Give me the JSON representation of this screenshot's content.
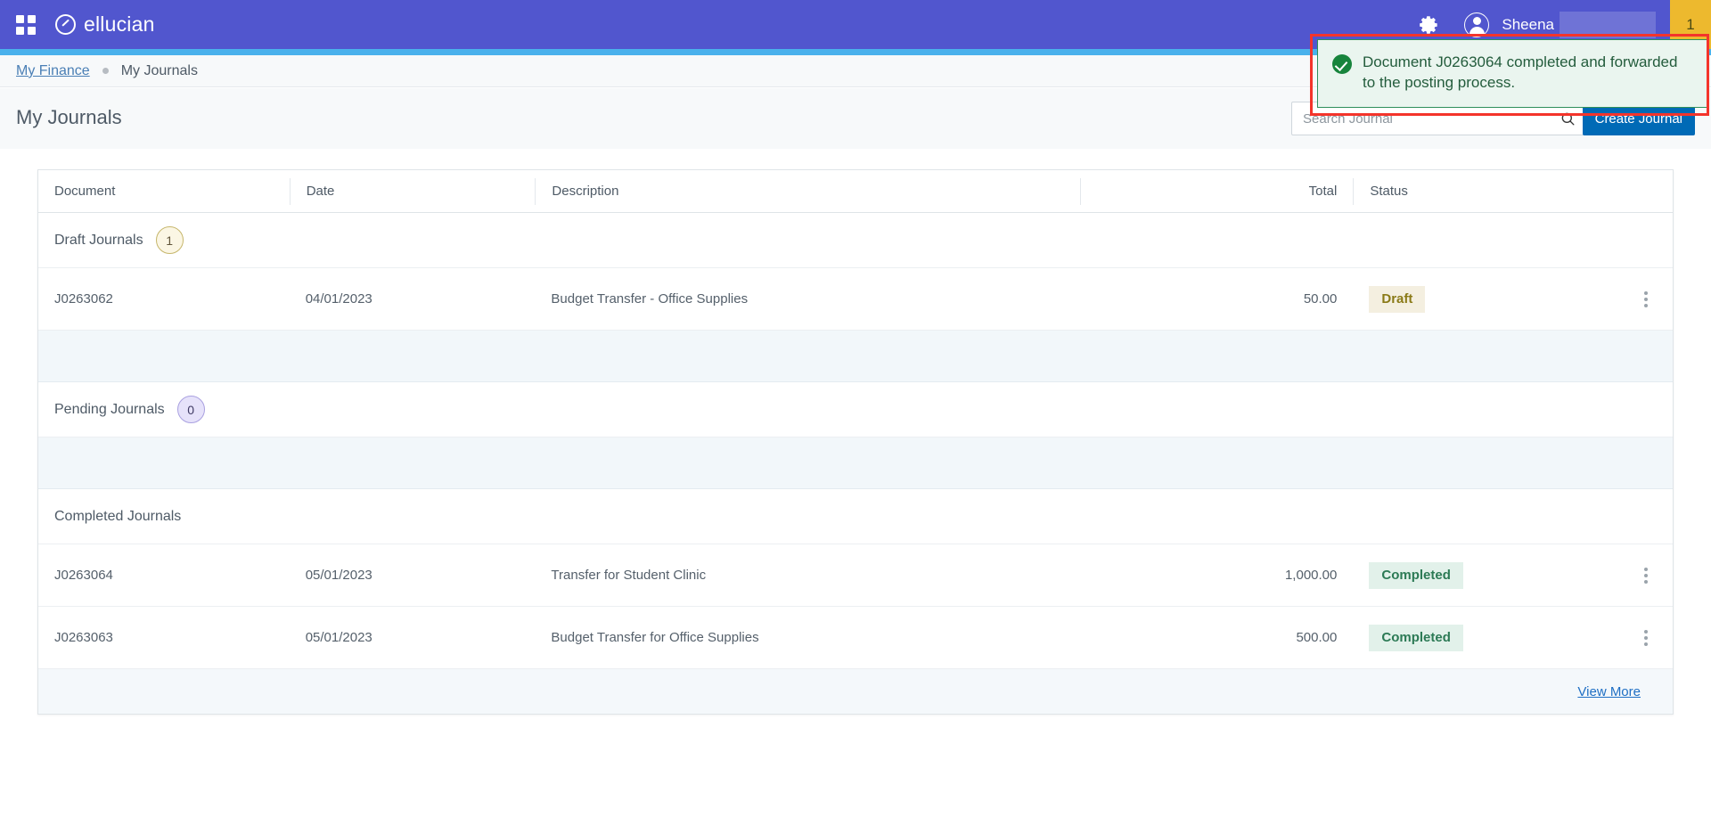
{
  "header": {
    "waffle_icon": "app-grid-icon",
    "brand": "ellucian",
    "gear_icon": "gear-icon",
    "avatar_icon": "user-avatar-icon",
    "user_name": "Sheena",
    "notification_count": "1"
  },
  "breadcrumb": {
    "parent": "My Finance",
    "current": "My Journals"
  },
  "page": {
    "title": "My Journals",
    "search_placeholder": "Search Journal",
    "search_value": "",
    "search_icon": "search-icon",
    "create_button": "Create Journal"
  },
  "toast": {
    "icon": "success-check-icon",
    "message": "Document J0263064 completed and forwarded to the posting process."
  },
  "table": {
    "columns": {
      "document": "Document",
      "date": "Date",
      "description": "Description",
      "total": "Total",
      "status": "Status"
    },
    "groups": [
      {
        "label": "Draft Journals",
        "count": "1",
        "rows": [
          {
            "document": "J0263062",
            "date": "04/01/2023",
            "description": "Budget Transfer - Office Supplies",
            "total": "50.00",
            "status": "Draft",
            "menu_icon": "kebab-menu-icon"
          }
        ]
      },
      {
        "label": "Pending Journals",
        "count": "0",
        "rows": []
      },
      {
        "label": "Completed Journals",
        "count": "",
        "rows": [
          {
            "document": "J0263064",
            "date": "05/01/2023",
            "description": "Transfer for Student Clinic",
            "total": "1,000.00",
            "status": "Completed",
            "menu_icon": "kebab-menu-icon"
          },
          {
            "document": "J0263063",
            "date": "05/01/2023",
            "description": "Budget Transfer for Office Supplies",
            "total": "500.00",
            "status": "Completed",
            "menu_icon": "kebab-menu-icon"
          }
        ]
      }
    ],
    "view_more": "View More"
  },
  "colors": {
    "header_purple": "#5156ce",
    "accent_blue": "#4ab1ec",
    "primary_button": "#006ab6",
    "badge_yellow": "#edb92e",
    "toast_green": "#2f8f5b",
    "annotation_red": "#f4342b",
    "draft_chip_bg": "#f4efe0",
    "completed_chip_bg": "#e2f1ea"
  }
}
